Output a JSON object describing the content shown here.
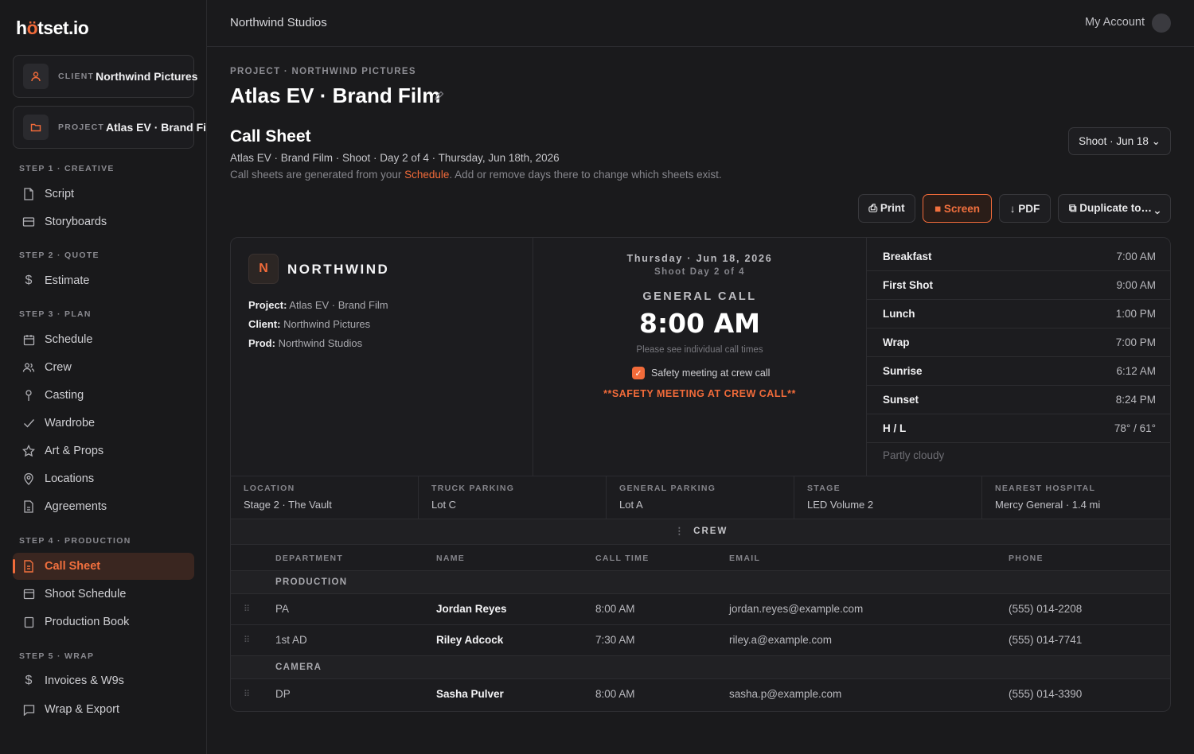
{
  "app": {
    "logo_pre": "h",
    "logo_accent": "ö",
    "logo_post": "tset.io"
  },
  "context": {
    "client_kind": "CLIENT",
    "client_value": "Northwind Pictures",
    "project_kind": "PROJECT",
    "project_value": "Atlas EV · Brand Film"
  },
  "sidebar": {
    "steps": [
      {
        "label": "STEP 1 · CREATIVE",
        "items": [
          {
            "label": "Script",
            "icon": "file-icon"
          },
          {
            "label": "Storyboards",
            "icon": "storyboard-icon"
          }
        ]
      },
      {
        "label": "STEP 2 · QUOTE",
        "items": [
          {
            "label": "Estimate",
            "icon": "dollar-icon"
          }
        ]
      },
      {
        "label": "STEP 3 · PLAN",
        "items": [
          {
            "label": "Schedule",
            "icon": "calendar-icon"
          },
          {
            "label": "Crew",
            "icon": "users-icon"
          },
          {
            "label": "Casting",
            "icon": "person-icon"
          },
          {
            "label": "Wardrobe",
            "icon": "check-icon"
          },
          {
            "label": "Art & Props",
            "icon": "star-icon"
          },
          {
            "label": "Locations",
            "icon": "pin-icon"
          },
          {
            "label": "Agreements",
            "icon": "document-icon"
          }
        ]
      },
      {
        "label": "STEP 4 · PRODUCTION",
        "items": [
          {
            "label": "Call Sheet",
            "icon": "call-sheet-icon",
            "active": true
          },
          {
            "label": "Shoot Schedule",
            "icon": "calendar-grid-icon"
          },
          {
            "label": "Production Book",
            "icon": "book-icon"
          }
        ]
      },
      {
        "label": "STEP 5 · WRAP",
        "items": [
          {
            "label": "Invoices & W9s",
            "icon": "dollar-icon"
          },
          {
            "label": "Wrap & Export",
            "icon": "chat-icon"
          }
        ]
      }
    ]
  },
  "topbar": {
    "studio": "Northwind Studios",
    "account": "My Account"
  },
  "header": {
    "breadcrumb": "PROJECT · NORTHWIND PICTURES",
    "title": "Atlas EV · Brand Film",
    "section_title": "Call Sheet",
    "subtitle": "Atlas EV · Brand Film · Shoot · Day 2 of 4 · Thursday, Jun 18th, 2026",
    "note_pre": "Call sheets are generated from your ",
    "note_link": "Schedule",
    "note_post": ". Add or remove days there to change which sheets exist.",
    "shoot_select": "Shoot · Jun 18 ⌄"
  },
  "toolbar": {
    "print": "⎙ Print",
    "screen": "■ Screen",
    "pdf": "↓ PDF",
    "duplicate": "⧉ Duplicate to… ⌄"
  },
  "sheet": {
    "company_initial": "N",
    "company_name": "NORTHWIND",
    "project_label": "Project:",
    "project_value": " Atlas EV · Brand Film",
    "client_label": "Client:",
    "client_value": " Northwind Pictures",
    "prod_label": "Prod:",
    "prod_value": " Northwind Studios",
    "date": "Thursday · Jun 18, 2026",
    "shoot_day": "Shoot Day 2 of 4",
    "general_call_label": "GENERAL CALL",
    "general_call_time": "8:00 AM",
    "call_note": "Please see individual call times",
    "safety_check_label": "Safety meeting at crew call",
    "safety_warning": "**SAFETY MEETING AT CREW CALL**",
    "times": [
      {
        "k": "Breakfast",
        "v": "7:00 AM"
      },
      {
        "k": "First Shot",
        "v": "9:00 AM"
      },
      {
        "k": "Lunch",
        "v": "1:00 PM"
      },
      {
        "k": "Wrap",
        "v": "7:00 PM"
      },
      {
        "k": "Sunrise",
        "v": "6:12 AM"
      },
      {
        "k": "Sunset",
        "v": "8:24 PM"
      },
      {
        "k": "H / L",
        "v": "78° / 61°"
      }
    ],
    "weather": "Partly cloudy",
    "locations": [
      {
        "k": "LOCATION",
        "v": "Stage 2 · The Vault"
      },
      {
        "k": "TRUCK PARKING",
        "v": "Lot C"
      },
      {
        "k": "GENERAL PARKING",
        "v": "Lot A"
      },
      {
        "k": "STAGE",
        "v": "LED Volume 2"
      },
      {
        "k": "NEAREST HOSPITAL",
        "v": "Mercy General · 1.4 mi"
      }
    ],
    "crew_header": "CREW",
    "crew_columns": [
      "DEPARTMENT",
      "NAME",
      "CALL TIME",
      "EMAIL",
      "PHONE"
    ],
    "departments": [
      {
        "name": "PRODUCTION",
        "rows": [
          {
            "role": "PA",
            "name": "Jordan Reyes",
            "call": "8:00 AM",
            "email": "jordan.reyes@example.com",
            "phone": "(555) 014-2208"
          },
          {
            "role": "1st AD",
            "name": "Riley Adcock",
            "call": "7:30 AM",
            "email": "riley.a@example.com",
            "phone": "(555) 014-7741"
          }
        ]
      },
      {
        "name": "CAMERA",
        "rows": [
          {
            "role": "DP",
            "name": "Sasha Pulver",
            "call": "8:00 AM",
            "email": "sasha.p@example.com",
            "phone": "(555) 014-3390"
          }
        ]
      }
    ]
  },
  "colors": {
    "accent": "#f26b3a",
    "background": "#1a1a1c",
    "panel": "#1c1c1f"
  }
}
